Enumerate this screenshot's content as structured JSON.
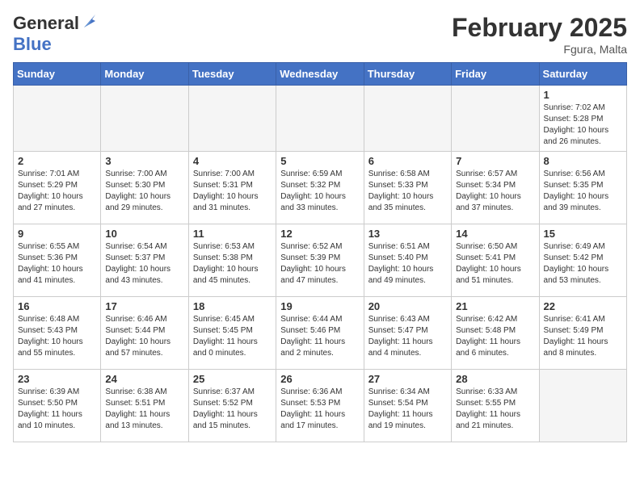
{
  "header": {
    "logo_general": "General",
    "logo_blue": "Blue",
    "month": "February 2025",
    "location": "Fgura, Malta"
  },
  "days_of_week": [
    "Sunday",
    "Monday",
    "Tuesday",
    "Wednesday",
    "Thursday",
    "Friday",
    "Saturday"
  ],
  "weeks": [
    [
      {
        "day": "",
        "info": ""
      },
      {
        "day": "",
        "info": ""
      },
      {
        "day": "",
        "info": ""
      },
      {
        "day": "",
        "info": ""
      },
      {
        "day": "",
        "info": ""
      },
      {
        "day": "",
        "info": ""
      },
      {
        "day": "1",
        "info": "Sunrise: 7:02 AM\nSunset: 5:28 PM\nDaylight: 10 hours\nand 26 minutes."
      }
    ],
    [
      {
        "day": "2",
        "info": "Sunrise: 7:01 AM\nSunset: 5:29 PM\nDaylight: 10 hours\nand 27 minutes."
      },
      {
        "day": "3",
        "info": "Sunrise: 7:00 AM\nSunset: 5:30 PM\nDaylight: 10 hours\nand 29 minutes."
      },
      {
        "day": "4",
        "info": "Sunrise: 7:00 AM\nSunset: 5:31 PM\nDaylight: 10 hours\nand 31 minutes."
      },
      {
        "day": "5",
        "info": "Sunrise: 6:59 AM\nSunset: 5:32 PM\nDaylight: 10 hours\nand 33 minutes."
      },
      {
        "day": "6",
        "info": "Sunrise: 6:58 AM\nSunset: 5:33 PM\nDaylight: 10 hours\nand 35 minutes."
      },
      {
        "day": "7",
        "info": "Sunrise: 6:57 AM\nSunset: 5:34 PM\nDaylight: 10 hours\nand 37 minutes."
      },
      {
        "day": "8",
        "info": "Sunrise: 6:56 AM\nSunset: 5:35 PM\nDaylight: 10 hours\nand 39 minutes."
      }
    ],
    [
      {
        "day": "9",
        "info": "Sunrise: 6:55 AM\nSunset: 5:36 PM\nDaylight: 10 hours\nand 41 minutes."
      },
      {
        "day": "10",
        "info": "Sunrise: 6:54 AM\nSunset: 5:37 PM\nDaylight: 10 hours\nand 43 minutes."
      },
      {
        "day": "11",
        "info": "Sunrise: 6:53 AM\nSunset: 5:38 PM\nDaylight: 10 hours\nand 45 minutes."
      },
      {
        "day": "12",
        "info": "Sunrise: 6:52 AM\nSunset: 5:39 PM\nDaylight: 10 hours\nand 47 minutes."
      },
      {
        "day": "13",
        "info": "Sunrise: 6:51 AM\nSunset: 5:40 PM\nDaylight: 10 hours\nand 49 minutes."
      },
      {
        "day": "14",
        "info": "Sunrise: 6:50 AM\nSunset: 5:41 PM\nDaylight: 10 hours\nand 51 minutes."
      },
      {
        "day": "15",
        "info": "Sunrise: 6:49 AM\nSunset: 5:42 PM\nDaylight: 10 hours\nand 53 minutes."
      }
    ],
    [
      {
        "day": "16",
        "info": "Sunrise: 6:48 AM\nSunset: 5:43 PM\nDaylight: 10 hours\nand 55 minutes."
      },
      {
        "day": "17",
        "info": "Sunrise: 6:46 AM\nSunset: 5:44 PM\nDaylight: 10 hours\nand 57 minutes."
      },
      {
        "day": "18",
        "info": "Sunrise: 6:45 AM\nSunset: 5:45 PM\nDaylight: 11 hours\nand 0 minutes."
      },
      {
        "day": "19",
        "info": "Sunrise: 6:44 AM\nSunset: 5:46 PM\nDaylight: 11 hours\nand 2 minutes."
      },
      {
        "day": "20",
        "info": "Sunrise: 6:43 AM\nSunset: 5:47 PM\nDaylight: 11 hours\nand 4 minutes."
      },
      {
        "day": "21",
        "info": "Sunrise: 6:42 AM\nSunset: 5:48 PM\nDaylight: 11 hours\nand 6 minutes."
      },
      {
        "day": "22",
        "info": "Sunrise: 6:41 AM\nSunset: 5:49 PM\nDaylight: 11 hours\nand 8 minutes."
      }
    ],
    [
      {
        "day": "23",
        "info": "Sunrise: 6:39 AM\nSunset: 5:50 PM\nDaylight: 11 hours\nand 10 minutes."
      },
      {
        "day": "24",
        "info": "Sunrise: 6:38 AM\nSunset: 5:51 PM\nDaylight: 11 hours\nand 13 minutes."
      },
      {
        "day": "25",
        "info": "Sunrise: 6:37 AM\nSunset: 5:52 PM\nDaylight: 11 hours\nand 15 minutes."
      },
      {
        "day": "26",
        "info": "Sunrise: 6:36 AM\nSunset: 5:53 PM\nDaylight: 11 hours\nand 17 minutes."
      },
      {
        "day": "27",
        "info": "Sunrise: 6:34 AM\nSunset: 5:54 PM\nDaylight: 11 hours\nand 19 minutes."
      },
      {
        "day": "28",
        "info": "Sunrise: 6:33 AM\nSunset: 5:55 PM\nDaylight: 11 hours\nand 21 minutes."
      },
      {
        "day": "",
        "info": ""
      }
    ]
  ]
}
